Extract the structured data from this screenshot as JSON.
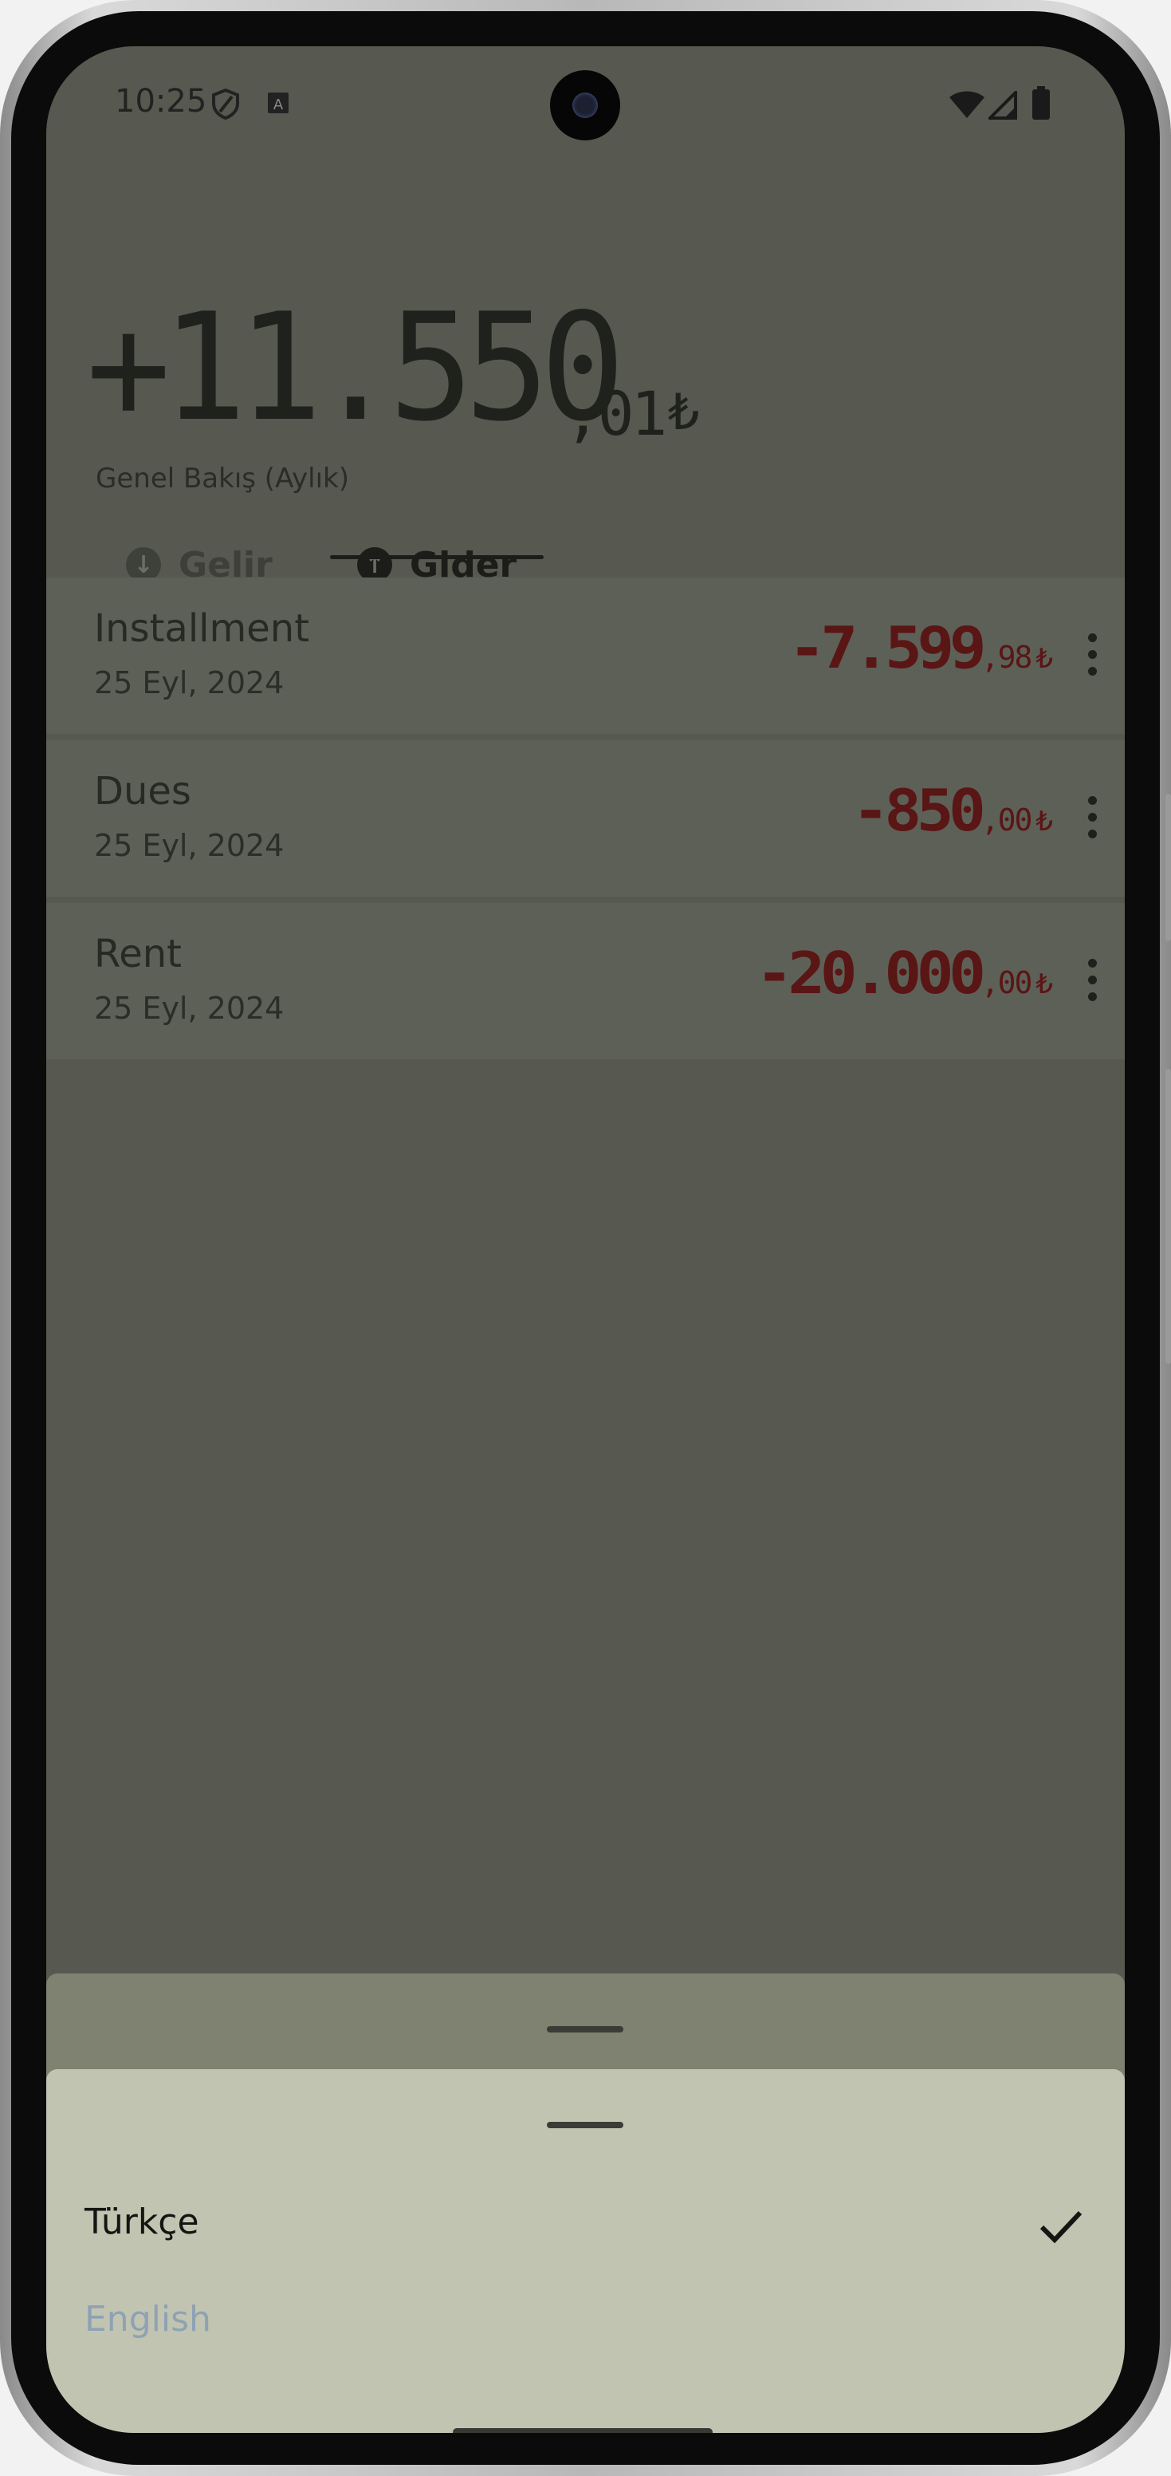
{
  "status_bar": {
    "time": "10:25",
    "icons": [
      "shield-icon",
      "keyboard-icon",
      "wifi-icon",
      "cellular-icon",
      "battery-icon"
    ]
  },
  "overview": {
    "balance_main": "+11.550",
    "balance_decimal": ",01",
    "currency": "₺",
    "label": "Genel Bakış (Aylık)"
  },
  "tabs": [
    {
      "label": "Gelir",
      "icon": "arrow-down-circle-icon",
      "selected": false
    },
    {
      "label": "Gider",
      "icon": "arrow-up-circle-icon",
      "selected": true
    }
  ],
  "transactions": [
    {
      "name": "Installment",
      "date": "25 Eyl, 2024",
      "amount_int": "-7.599",
      "amount_dec": ",98",
      "currency": "₺"
    },
    {
      "name": "Dues",
      "date": "25 Eyl, 2024",
      "amount_int": "-850",
      "amount_dec": ",00",
      "currency": "₺"
    },
    {
      "name": "Rent",
      "date": "25 Eyl, 2024",
      "amount_int": "-20.000",
      "amount_dec": ",00",
      "currency": "₺"
    }
  ],
  "language_sheet": {
    "options": [
      {
        "label": "Türkçe",
        "selected": true
      },
      {
        "label": "English",
        "selected": false
      }
    ]
  },
  "colors": {
    "scrim_background": "#575950",
    "list_item_background": "#5d6057",
    "expense_amount": "#5a1515",
    "sheet_background": "#c1c4b0",
    "sheet_back_background": "#7f8171",
    "unselected_option": "#8fa2b4"
  }
}
